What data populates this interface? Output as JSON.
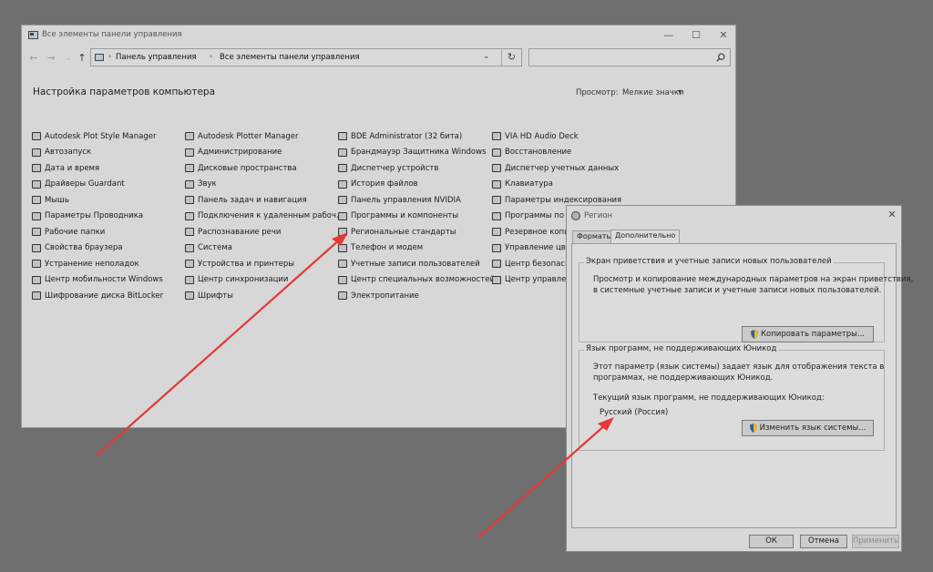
{
  "window": {
    "title": "Все элементы панели управления",
    "minimize_glyph": "—",
    "maximize_glyph": "☐",
    "close_glyph": "✕",
    "icon": "control-panel-icon"
  },
  "navigation": {
    "back_glyph": "←",
    "forward_glyph": "→",
    "recent_glyph": "⌄",
    "up_glyph": "↑",
    "address": {
      "separator": "›",
      "crumb_1": "Панель управления",
      "crumb_2": "Все элементы панели управления",
      "dropdown_glyph": "⌄",
      "refresh_glyph": "↻"
    },
    "search_placeholder": ""
  },
  "header": {
    "title": "Настройка параметров компьютера",
    "view_label": "Просмотр:",
    "view_value": "Мелкие значки",
    "view_caret": "▾"
  },
  "columns": [
    [
      "Autodesk Plot Style Manager",
      "Автозапуск",
      "Дата и время",
      "Драйверы Guardant",
      "Мышь",
      "Параметры Проводника",
      "Рабочие папки",
      "Свойства браузера",
      "Устранение неполадок",
      "Центр мобильности Windows",
      "Шифрование диска BitLocker"
    ],
    [
      "Autodesk Plotter Manager",
      "Администрирование",
      "Дисковые пространства",
      "Звук",
      "Панель задач и навигация",
      "Подключения к удаленным рабоч...",
      "Распознавание речи",
      "Система",
      "Устройства и принтеры",
      "Центр синхронизации",
      "Шрифты"
    ],
    [
      "BDE Administrator (32 бита)",
      "Брандмауэр Защитника Windows",
      "Диспетчер устройств",
      "История файлов",
      "Панель управления NVIDIA",
      "Программы и компоненты",
      "Региональные стандарты",
      "Телефон и модем",
      "Учетные записи пользователей",
      "Центр специальных возможностей",
      "Электропитание"
    ],
    [
      "VIA HD Audio Deck",
      "Восстановление",
      "Диспетчер учетных данных",
      "Клавиатура",
      "Параметры индексирования",
      "Программы по у",
      "Резервное копир",
      "Управление цвет",
      "Центр безопасно",
      "Центр управлени",
      ""
    ]
  ],
  "dialog": {
    "title": "Регион",
    "close_glyph": "✕",
    "tabs": [
      "Форматы",
      "Дополнительно"
    ],
    "group1": {
      "title": "Экран приветствия и учетные записи новых пользователей",
      "line1": "Просмотр и копирование международных параметров на экран приветствия,",
      "line2": "в системные учетные записи и учетные записи новых пользователей.",
      "button": "Копировать параметры..."
    },
    "group2": {
      "title": "Язык программ, не поддерживающих Юникод",
      "line1": "Этот параметр (язык системы) задает язык для отображения текста в",
      "line2": "программах, не поддерживающих Юникод.",
      "current_label": "Текущий язык программ, не поддерживающих Юникод:",
      "current_value": "Русский (Россия)",
      "button": "Изменить язык системы..."
    },
    "ok": "ОК",
    "cancel": "Отмена",
    "apply": "Применить"
  },
  "annotation_color": "#e53935"
}
